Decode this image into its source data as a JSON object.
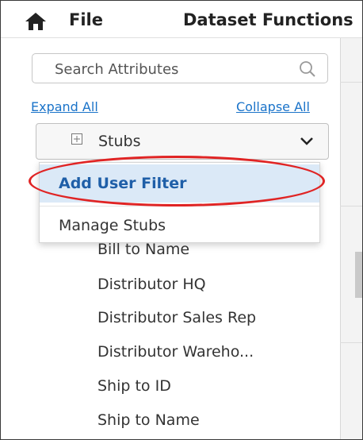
{
  "menubar": {
    "file_label": "File",
    "dataset_label": "Dataset Functions"
  },
  "search": {
    "placeholder": "Search Attributes"
  },
  "links": {
    "expand_all": "Expand All",
    "collapse_all": "Collapse All"
  },
  "stubs": {
    "label": "Stubs"
  },
  "dropdown": {
    "add_user_filter": "Add User Filter",
    "manage_stubs": "Manage Stubs"
  },
  "list": [
    "Bill to Name",
    "Distributor HQ",
    "Distributor Sales Rep",
    "Distributor Wareho...",
    "Ship to ID",
    "Ship to Name"
  ],
  "colors": {
    "link": "#1a73c9",
    "highlight_bg": "#dbe9f7",
    "annotation": "#e02424"
  }
}
